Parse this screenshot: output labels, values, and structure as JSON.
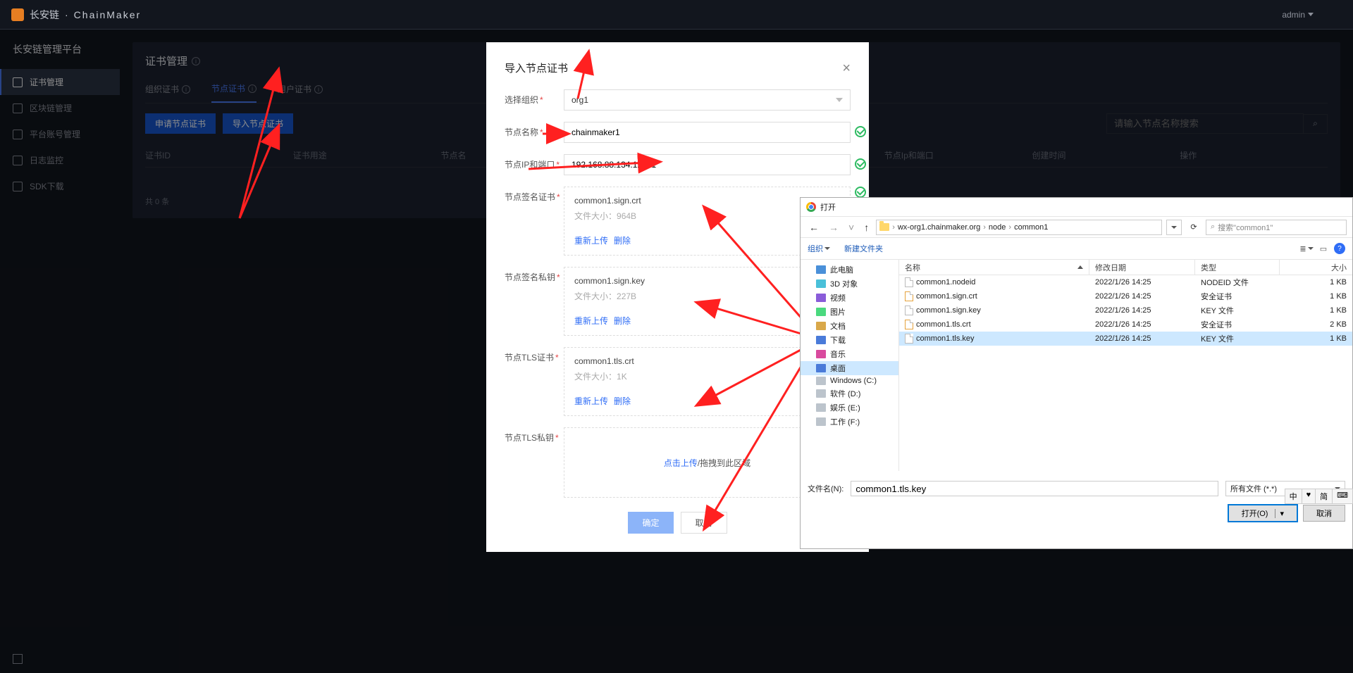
{
  "brand": {
    "cn": "长安链",
    "en": "ChainMaker",
    "sep": "·"
  },
  "user": {
    "name": "admin"
  },
  "sidebar": {
    "title": "长安链管理平台",
    "items": [
      {
        "label": "证书管理"
      },
      {
        "label": "区块链管理"
      },
      {
        "label": "平台账号管理"
      },
      {
        "label": "日志监控"
      },
      {
        "label": "SDK下载"
      }
    ]
  },
  "page": {
    "title": "证书管理",
    "tabs": [
      {
        "label": "组织证书"
      },
      {
        "label": "节点证书"
      },
      {
        "label": "用户证书"
      }
    ],
    "buttons": {
      "apply": "申请节点证书",
      "import": "导入节点证书"
    },
    "search_placeholder": "请输入节点名称搜索",
    "columns": [
      "证书ID",
      "证书用途",
      "节点名",
      "节点Ip和端口",
      "创建时间",
      "操作"
    ],
    "empty": "共 0 条"
  },
  "modal": {
    "title": "导入节点证书",
    "labels": {
      "org": "选择组织",
      "node_name": "节点名称",
      "ip_port": "节点IP和端口",
      "sign_cert": "节点签名证书",
      "sign_key": "节点签名私钥",
      "tls_cert": "节点TLS证书",
      "tls_key": "节点TLS私钥"
    },
    "values": {
      "org": "org1",
      "node_name": "chainmaker1",
      "ip_port": "192.168.88.134:12301"
    },
    "uploads": {
      "sign_cert": {
        "name": "common1.sign.crt",
        "size": "964B"
      },
      "sign_key": {
        "name": "common1.sign.key",
        "size": "227B"
      },
      "tls_cert": {
        "name": "common1.tls.crt",
        "size": "1K"
      }
    },
    "size_label": "文件大小：",
    "reupload": "重新上传",
    "delete": "删除",
    "click_upload": "点击上传",
    "drag_text": "/拖拽到此区域",
    "ok": "确定",
    "cancel": "取消"
  },
  "filepicker": {
    "title": "打开",
    "breadcrumb": [
      "wx-org1.chainmaker.org",
      "node",
      "common1"
    ],
    "search_hint": "搜索\"common1\"",
    "toolbar": {
      "organize": "组织",
      "newfolder": "新建文件夹"
    },
    "side": [
      "此电脑",
      "3D 对象",
      "视频",
      "图片",
      "文档",
      "下载",
      "音乐",
      "桌面",
      "Windows (C:)",
      "软件 (D:)",
      "娱乐 (E:)",
      "工作 (F:)"
    ],
    "columns": {
      "name": "名称",
      "date": "修改日期",
      "type": "类型",
      "size": "大小"
    },
    "files": [
      {
        "name": "common1.nodeid",
        "date": "2022/1/26 14:25",
        "type": "NODEID 文件",
        "size": "1 KB"
      },
      {
        "name": "common1.sign.crt",
        "date": "2022/1/26 14:25",
        "type": "安全证书",
        "size": "1 KB"
      },
      {
        "name": "common1.sign.key",
        "date": "2022/1/26 14:25",
        "type": "KEY 文件",
        "size": "1 KB"
      },
      {
        "name": "common1.tls.crt",
        "date": "2022/1/26 14:25",
        "type": "安全证书",
        "size": "2 KB"
      },
      {
        "name": "common1.tls.key",
        "date": "2022/1/26 14:25",
        "type": "KEY 文件",
        "size": "1 KB"
      }
    ],
    "filename_label": "文件名(N):",
    "filename_value": "common1.tls.key",
    "filter": "所有文件 (*.*)",
    "open_btn": "打开(O)",
    "cancel_btn": "取消"
  },
  "ime": {
    "zhong": "中",
    "pin": "简",
    "punct": "，"
  }
}
